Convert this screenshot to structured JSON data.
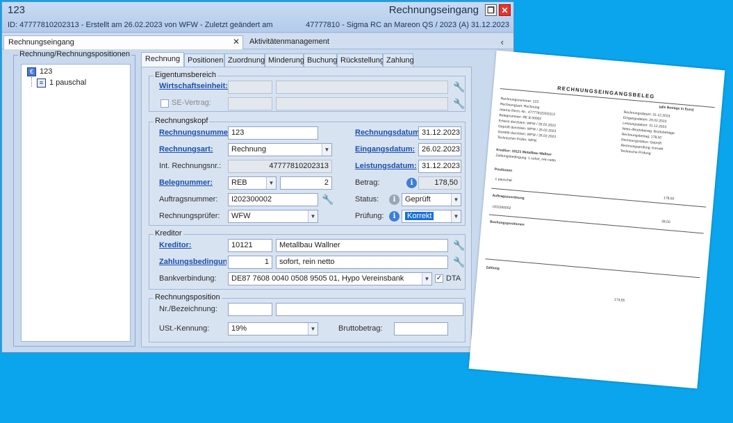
{
  "window": {
    "number": "123",
    "id_line": "ID: 47777810202313 - Erstellt am 26.02.2023 von WFW - Zuletzt geändert am",
    "title": "Rechnungseingang",
    "subtitle": "47777810 - Sigma RC an Mareon QS / 2023 (A)  31.12.2023"
  },
  "tabs": {
    "active": "Rechnungseingang",
    "inactive": "Aktivitätenmanagement"
  },
  "tree": {
    "legend": "Rechnung/Rechnungspositionen",
    "items": [
      {
        "label": "123"
      },
      {
        "label": "1 pauschal"
      }
    ]
  },
  "subtabs": [
    "Rechnung",
    "Positionen",
    "Zuordnung",
    "Minderung",
    "Buchung",
    "Rückstellung",
    "Zahlung"
  ],
  "eigentum": {
    "legend": "Eigentumsbereich",
    "wirtschaft_label": "Wirtschaftseinheit:",
    "se_label": "SE-Vertrag:"
  },
  "kopf": {
    "legend": "Rechnungskopf",
    "rechnungsnummer_label": "Rechnungsnumme",
    "rechnungsnummer_value": "123",
    "rechnungsdatum_label": "Rechnungsdatum:",
    "rechnungsdatum_value": "31.12.2023",
    "rechnungsart_label": "Rechnungsart:",
    "rechnungsart_value": "Rechnung",
    "eingangsdatum_label": "Eingangsdatum:",
    "eingangsdatum_value": "26.02.2023",
    "intnr_label": "Int. Rechnungsnr.:",
    "intnr_value": "47777810202313",
    "leistungsdatum_label": "Leistungsdatum:",
    "leistungsdatum_value": "31.12.2023",
    "beleg_label": "Belegnummer:",
    "beleg_type": "REB",
    "beleg_value": "2",
    "betrag_label": "Betrag:",
    "betrag_value": "178,50",
    "auftrag_label": "Auftragsnummer:",
    "auftrag_value": "I202300002",
    "status_label": "Status:",
    "status_value": "Geprüft",
    "pruefer_label": "Rechnungsprüfer:",
    "pruefer_value": "WFW",
    "pruefung_label": "Prüfung:",
    "pruefung_value": "Korrekt"
  },
  "kreditor": {
    "legend": "Kreditor",
    "kreditor_label": "Kreditor:",
    "kreditor_nr": "10121",
    "kreditor_name": "Metallbau Wallner",
    "zb_label": "Zahlungsbedingung",
    "zb_nr": "1",
    "zb_text": "sofort, rein netto",
    "bank_label": "Bankverbindung:",
    "bank_value": "DE87 7608 0040 0508 9505 01, Hypo Vereinsbank",
    "dta_label": "DTA"
  },
  "position": {
    "legend": "Rechnungsposition",
    "nr_label": "Nr./Bezeichnung:",
    "ust_label": "USt.-Kennung:",
    "ust_value": "19%",
    "brutto_label": "Bruttobetrag:"
  },
  "paper": {
    "title": "RECHNUNGSEINGANGSBELEG",
    "header_right": "(alle Beträge in Euro)",
    "rows_left": [
      "Rechnungsnummer:    123",
      "Rechnungsart:            Rechnung",
      "Interne Rech.-Nr.:       47777810202313",
      "Belegnummer:             RE B 00002",
      "Erfasst durch/am:        WFW / 26.02.2023",
      "Geprüft durch/am:        WFW / 26.02.2023",
      "Gezahlt durch/am:        WFW / 26.02.2023",
      "Technischer Prüfer:      WFW"
    ],
    "rows_right": [
      "Rechnungsdatum:          31.12.2023",
      "Eingangsdatum:           26.02.2023",
      "Leistungsdatum:          31.12.2023",
      "Netto-/Bruttobetrag:     Bruttobeträge",
      "Rechnungsbetrag:         178,50",
      "Rechnungsstatus:         Geprüft",
      "Rechnungsprüfung:        Korrekt",
      "Technische Prüfung:"
    ],
    "kreditor": "Kreditor:                    10121 Metallbau Wallner",
    "zahlung": "Zahlungsbedingung:     1 sofort, rein netto",
    "positionen": "Positionen",
    "pos_row": "1   pauschal",
    "auftrag_head": "Auftragszuordnung",
    "auftrag_row": "I202300002",
    "buchung_head": "Buchungspositionen",
    "zahlung_head": "Zahlung",
    "amount1": "178,50",
    "amount2": "28,50",
    "amount3": "174,65"
  }
}
